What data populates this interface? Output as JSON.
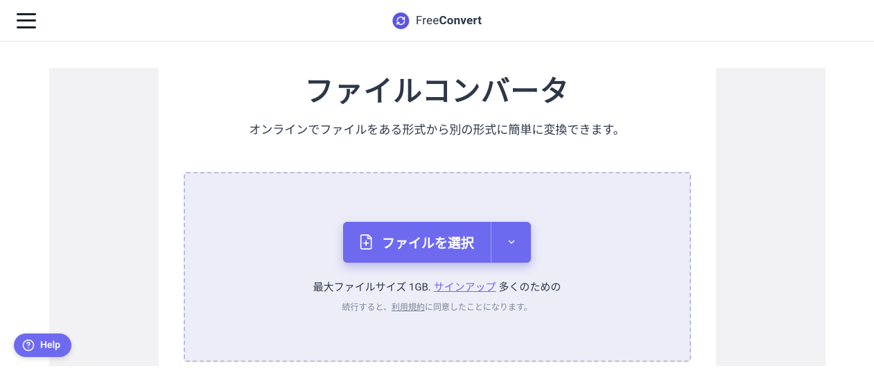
{
  "header": {
    "brand_light": "Free",
    "brand_bold": "Convert"
  },
  "hero": {
    "title": "ファイルコンバータ",
    "subtitle": "オンラインでファイルをある形式から別の形式に簡単に変換できます。"
  },
  "dropzone": {
    "choose_label": "ファイルを選択",
    "max_prefix": "最大ファイルサイズ 1GB. ",
    "signup_link": "サインアップ",
    "max_suffix": " 多くのための",
    "terms_prefix": "続行すると、",
    "terms_link": "利用規約",
    "terms_suffix": "に同意したことになります。"
  },
  "help": {
    "label": "Help"
  }
}
